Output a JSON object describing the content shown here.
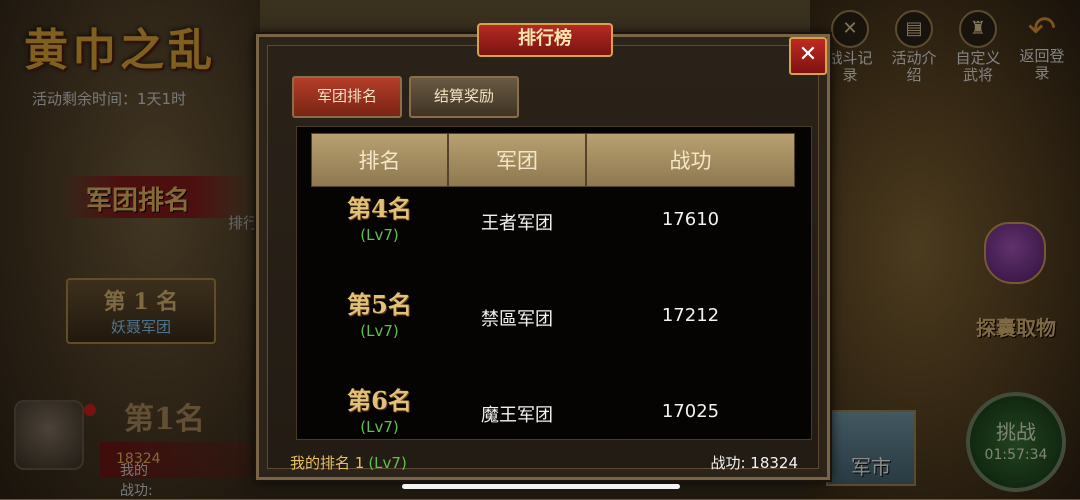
{
  "background": {
    "event_title": "黄巾之乱",
    "remaining_time": "活动剩余时间：1天1时",
    "left_banner": "军团排名",
    "left_sub": "排行",
    "rank_card": {
      "rank": "第 1 名",
      "name": "妖聂军团"
    },
    "left_rank": "第1名",
    "my_power_label": "我的战功:",
    "my_power_value": "18324",
    "top_icons": [
      {
        "label": "战斗记录",
        "icon": "battle-record-icon",
        "glyph": "✕"
      },
      {
        "label": "活动介绍",
        "icon": "activity-intro-icon",
        "glyph": "▤"
      },
      {
        "label": "自定义武将",
        "icon": "custom-general-icon",
        "glyph": "♜"
      },
      {
        "label": "返回登录",
        "icon": "back-arrow-icon",
        "glyph": "↶"
      }
    ],
    "bag_label": "探囊取物",
    "challenge": {
      "label": "挑战",
      "countdown": "01:57:34"
    },
    "market_label": "军市"
  },
  "dialog": {
    "title": "排行榜",
    "close_glyph": "✕",
    "tabs": [
      {
        "label": "军团排名",
        "active": true
      },
      {
        "label": "结算奖励",
        "active": false
      }
    ],
    "table": {
      "headers": [
        "排名",
        "军团",
        "战功"
      ],
      "rows": [
        {
          "rank": "第4名",
          "level": "(Lv7)",
          "legion": "王者军团",
          "power": "17610"
        },
        {
          "rank": "第5名",
          "level": "(Lv7)",
          "legion": "禁區军团",
          "power": "17212"
        },
        {
          "rank": "第6名",
          "level": "(Lv7)",
          "legion": "魔王军团",
          "power": "17025"
        }
      ]
    },
    "footer": {
      "my_rank": "我的排名 1",
      "my_level": "(Lv7)",
      "power_label": "战功:",
      "power_value": "18324"
    }
  },
  "colors": {
    "accent_gold": "#e3c07a",
    "level_green": "#5fc24a",
    "title_red": "#b52a22"
  }
}
